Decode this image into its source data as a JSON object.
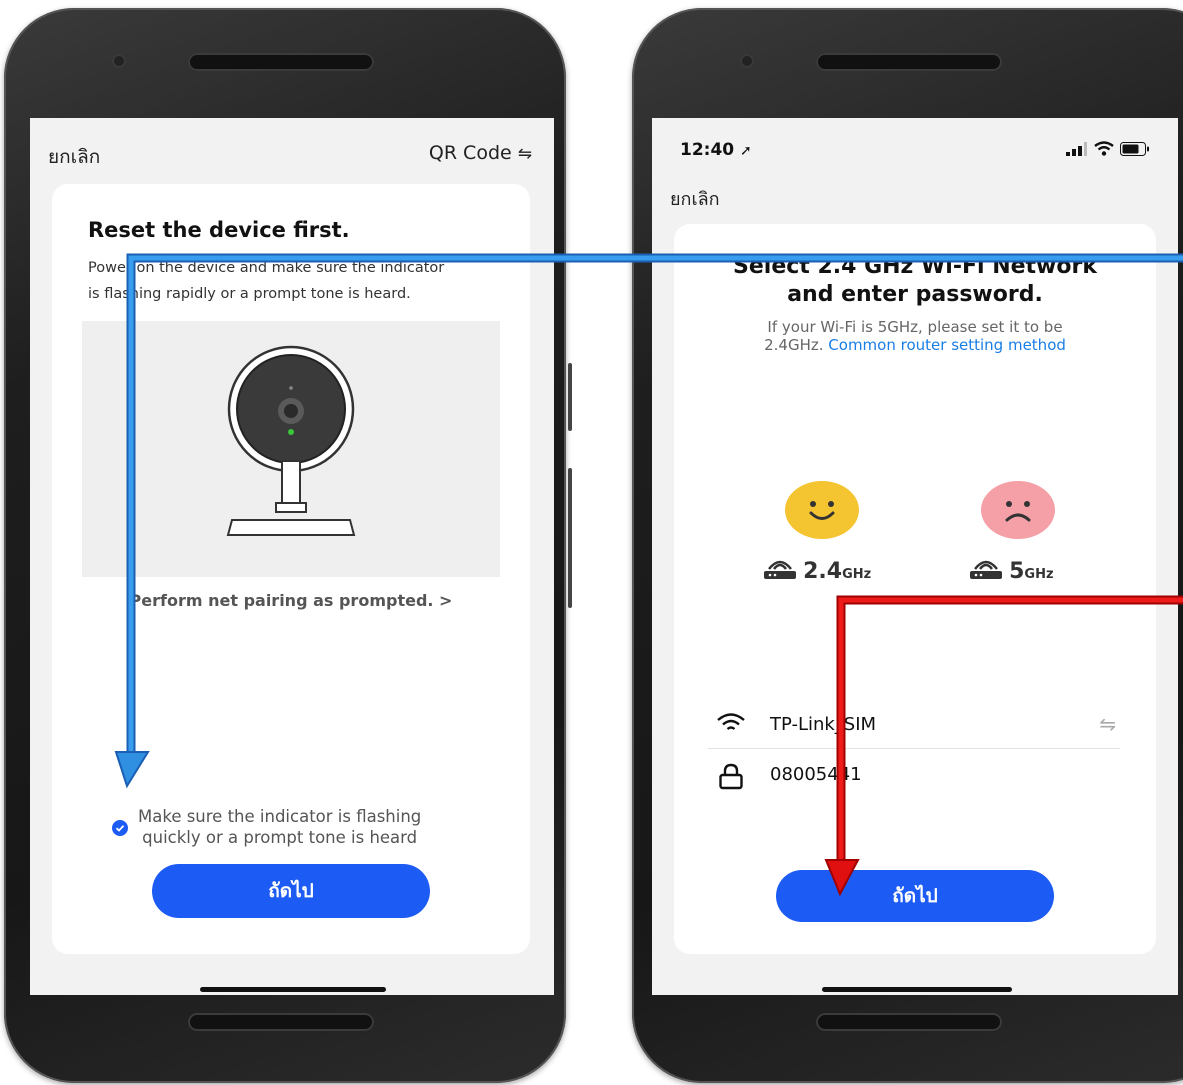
{
  "left_screen": {
    "cancel_label": "ยกเลิก",
    "qr_label": "QR Code",
    "qr_icon": "swap-arrows-icon",
    "title": "Reset the device first.",
    "description_line1": "Power on the device and make sure the indicator",
    "description_line2": "is flashing rapidly or a prompt tone is heard.",
    "illustration": "security-camera-icon",
    "pairing_link": "Perform net pairing as prompted. >",
    "checkbox_checked": true,
    "checkbox_line1": "Make sure the indicator is flashing",
    "checkbox_line2": "quickly or a prompt tone is heard",
    "next_label": "ถัดไป"
  },
  "right_screen": {
    "time": "12:40",
    "cancel_label": "ยกเลิก",
    "title_line1": "Select 2.4 GHz Wi-Fi Network",
    "title_line2": "and enter password.",
    "hint_line1": "If your Wi-Fi is 5GHz, please set it to be",
    "hint_prefix": "2.4GHz.",
    "hint_link": "Common router setting method",
    "band_ok_value": "2.4",
    "band_ok_unit": "GHz",
    "band_bad_value": "5",
    "band_bad_unit": "GHz",
    "wifi_name": "TP-Link_SIM",
    "wifi_password": "08005441",
    "next_label": "ถัดไป"
  },
  "colors": {
    "accent_blue": "#1d5bf5",
    "link_blue": "#1a7ee6",
    "arrow_blue": "#2f8fe0",
    "arrow_red": "#e01010",
    "happy_face": "#f5c431",
    "sad_face": "#f4a0a6"
  }
}
